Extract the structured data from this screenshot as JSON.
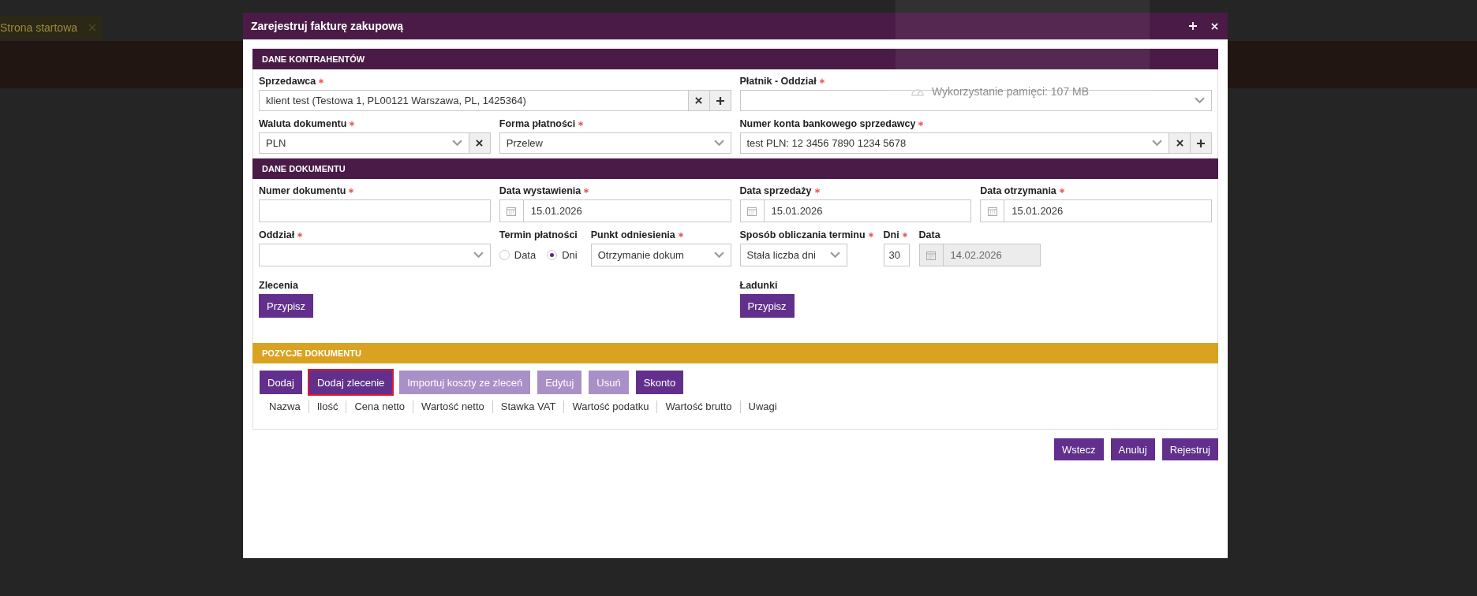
{
  "background": {
    "tab": {
      "label": "Strona startowa"
    }
  },
  "memory_popup": {
    "text": "Wykorzystanie pamięci: 107 MB"
  },
  "dialog": {
    "title": "Zarejestruj fakturę zakupową",
    "contractors": {
      "title": "DANE KONTRAHENTÓW",
      "seller": {
        "label": "Sprzedawca",
        "required": true,
        "value": "klient test (Testowa 1, PL00121 Warszawa, PL, 1425364)"
      },
      "payer_branch": {
        "label": "Płatnik - Oddział",
        "required": true
      },
      "currency": {
        "label": "Waluta dokumentu",
        "required": true,
        "value": "PLN"
      },
      "payment_form": {
        "label": "Forma płatności",
        "required": true,
        "value": "Przelew"
      },
      "bank_account": {
        "label": "Numer konta bankowego sprzedawcy",
        "required": true,
        "value": "test PLN: 12 3456 7890 1234 5678"
      }
    },
    "document": {
      "title": "DANE DOKUMENTU",
      "number": {
        "label": "Numer dokumentu",
        "required": true
      },
      "issue_date": {
        "label": "Data wystawienia",
        "required": true,
        "value": "15.01.2026"
      },
      "sale_date": {
        "label": "Data sprzedaży",
        "required": true,
        "value": "15.01.2026"
      },
      "receipt_date": {
        "label": "Data otrzymania",
        "required": true,
        "value": "15.01.2026"
      },
      "branch": {
        "label": "Oddział",
        "required": true
      },
      "payment_term": {
        "label": "Termin płatności",
        "required": false,
        "options": [
          {
            "label": "Data",
            "selected": false
          },
          {
            "label": "Dni",
            "selected": true
          }
        ]
      },
      "reference_point": {
        "label": "Punkt odniesienia",
        "required": true,
        "value": "Otrzymanie dokum"
      },
      "term_method": {
        "label": "Sposób obliczania terminu",
        "required": true,
        "value": "Stała liczba dni"
      },
      "days": {
        "label": "Dni",
        "required": true,
        "value": "30"
      },
      "due_date": {
        "label": "Data",
        "required": false,
        "value": "14.02.2026",
        "disabled": true
      },
      "orders": {
        "label": "Zlecenia",
        "button": "Przypisz"
      },
      "loads": {
        "label": "Ładunki",
        "button": "Przypisz"
      }
    },
    "items": {
      "title": "POZYCJE DOKUMENTU",
      "buttons": [
        {
          "label": "Dodaj",
          "disabled": false,
          "focused": false
        },
        {
          "label": "Dodaj zlecenie",
          "disabled": false,
          "focused": true
        },
        {
          "label": "Importuj koszty ze zleceń",
          "disabled": true,
          "focused": false
        },
        {
          "label": "Edytuj",
          "disabled": true,
          "focused": false
        },
        {
          "label": "Usuń",
          "disabled": true,
          "focused": false
        },
        {
          "label": "Skonto",
          "disabled": false,
          "focused": false
        }
      ],
      "columns": [
        "Nazwa",
        "Ilość",
        "Cena netto",
        "Wartość netto",
        "Stawka VAT",
        "Wartość podatku",
        "Wartość brutto",
        "Uwagi"
      ]
    },
    "footer_buttons": [
      "Wstecz",
      "Anuluj",
      "Rejestruj"
    ]
  }
}
